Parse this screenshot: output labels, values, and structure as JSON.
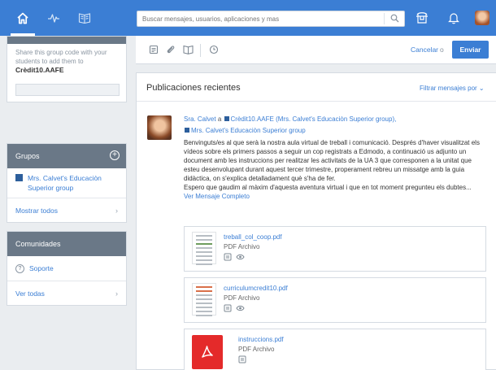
{
  "topbar": {
    "search_placeholder": "Buscar mensajes, usuarios, aplicaciones y mas",
    "accent": "#3b7ed4"
  },
  "sidebar": {
    "code_text": "Share this group code with your students to add them to",
    "code_value": "Crèdit10.AAFE",
    "groups_title": "Grupos",
    "groups": [
      {
        "label": "Mrs. Calvet's Educaciòn Superior group"
      }
    ],
    "show_all": "Mostrar todos",
    "communities_title": "Comunidades",
    "communities": [
      {
        "label": "Soporte",
        "icon": "help-icon"
      }
    ],
    "see_all": "Ver todas"
  },
  "compose": {
    "cancel": "Cancelar",
    "or": "o",
    "send": "Enviar"
  },
  "feed": {
    "title": "Publicaciones recientes",
    "filter": "Filtrar mensajes por",
    "post": {
      "author": "Sra. Calvet",
      "a": "a",
      "target1": "Crèdit10.AAFE (Mrs. Calvet's Educaciòn Superior group),",
      "target2": "Mrs. Calvet's Educaciòn Superior group",
      "body": "Benvinguts/es al que serà la nostra aula virtual de treball i comunicació. Després d'haver visualitzat els vídeos sobre els primers passos a seguir un cop registrats a Edmodo, a continuació us adjunto un document amb les instruccions per realitzar les activitats de la UA 3 que corresponen a la unitat que esteu desenvolupant durant aquest tercer trimestre, properament rebreu un missatge amb la guia didàctica, on s'explica detalladament què s'ha de fer.",
      "body2": "Espero que gaudim al màxim d'aquesta aventura virtual i que en tot moment pregunteu els dubtes...",
      "more": "Ver Mensaje Completo"
    },
    "attachments": [
      {
        "name": "treball_col_coop.pdf",
        "type": "PDF Archivo"
      },
      {
        "name": "curriculumcredit10.pdf",
        "type": "PDF Archivo"
      },
      {
        "name": "instruccions.pdf",
        "type": "PDF Archivo"
      }
    ]
  }
}
